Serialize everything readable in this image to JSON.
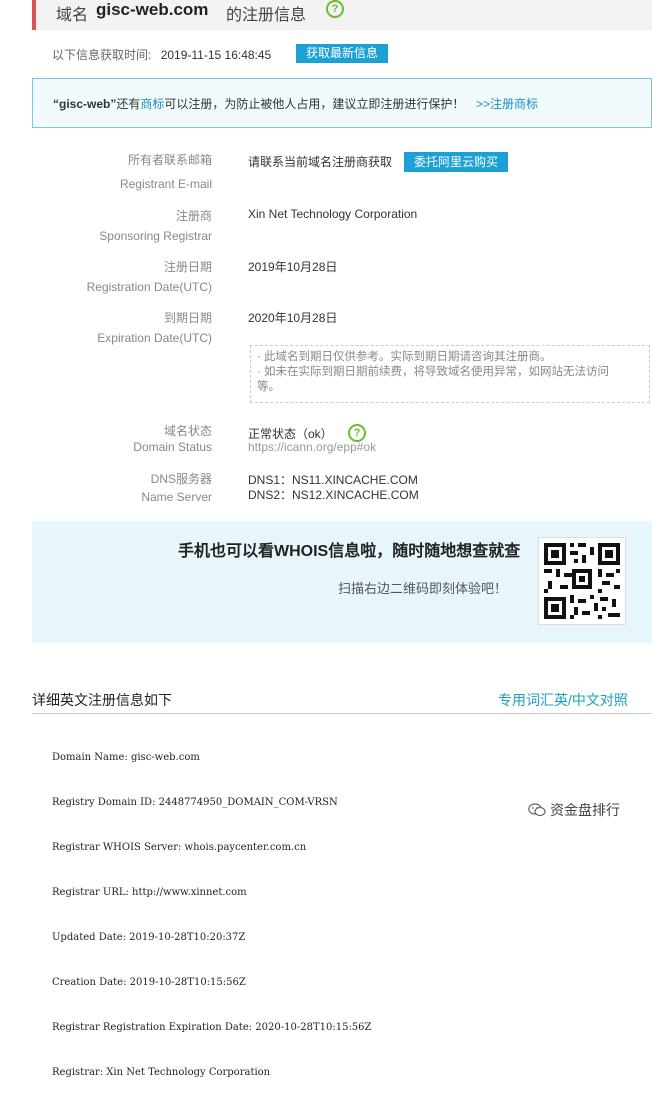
{
  "header": {
    "label": "域名",
    "domain": "gisc-web.com",
    "suffix": "的注册信息"
  },
  "fetch": {
    "label": "以下信息获取时间:",
    "time": "2019-11-15 16:48:45",
    "button": "获取最新信息"
  },
  "notice": {
    "domain_quoted": "“gisc-web”",
    "text1": "还有",
    "trademark": "商标",
    "text2": "可以注册，为防止被他人占用，建议立即注册进行保护！",
    "link": ">>注册商标"
  },
  "records": {
    "email": {
      "label_cn": "所有者联系邮箱",
      "label_en": "Registrant E-mail",
      "value": "请联系当前域名注册商获取",
      "button": "委托阿里云购买"
    },
    "registrar": {
      "label_cn": "注册商",
      "label_en": "Sponsoring Registrar",
      "value": "Xin Net Technology Corporation"
    },
    "reg_date": {
      "label_cn": "注册日期",
      "label_en": "Registration Date(UTC)",
      "value": "2019年10月28日"
    },
    "exp_date": {
      "label_cn": "到期日期",
      "label_en": "Expiration Date(UTC)",
      "value": "2020年10月28日",
      "note1": "· 此域名到期日仅供参考。实际到期日期请咨询其注册商。",
      "note2": "· 如未在实际到期日期前续费，将导致域名使用异常，如网站无法访问",
      "note3": "等。"
    },
    "status": {
      "label_cn": "域名状态",
      "label_en": "Domain Status",
      "value": "正常状态（ok）",
      "link": "https://icann.org/epp#ok"
    },
    "dns": {
      "label_cn": "DNS服务器",
      "label_en": "Name Server",
      "dns1": "DNS1：NS11.XINCACHE.COM",
      "dns2": "DNS2：NS12.XINCACHE.COM"
    }
  },
  "promo": {
    "title": "手机也可以看WHOIS信息啦，随时随地想查就查",
    "subtitle": "扫描右边二维码即刻体验吧！"
  },
  "detail": {
    "title": "详细英文注册信息如下",
    "link": "专用词汇英/中文对照",
    "lines": [
      "Domain Name: gisc-web.com",
      "Registry Domain ID: 2448774950_DOMAIN_COM-VRSN",
      "Registrar WHOIS Server: whois.paycenter.com.cn",
      "Registrar URL: http://www.xinnet.com",
      "Updated Date: 2019-10-28T10:20:37Z",
      "Creation Date: 2019-10-28T10:15:56Z",
      "Registrar Registration Expiration Date: 2020-10-28T10:15:56Z",
      "Registrar: Xin Net Technology Corporation"
    ]
  },
  "watermark": "资金盘排行",
  "icons": {
    "help": "help-circle-icon",
    "qr": "qr-code-icon",
    "watermark": "wechat-icon"
  },
  "colors": {
    "accent_blue": "#1ca1d4",
    "help_green": "#6dbb2e",
    "header_bar": "#d9534f"
  }
}
